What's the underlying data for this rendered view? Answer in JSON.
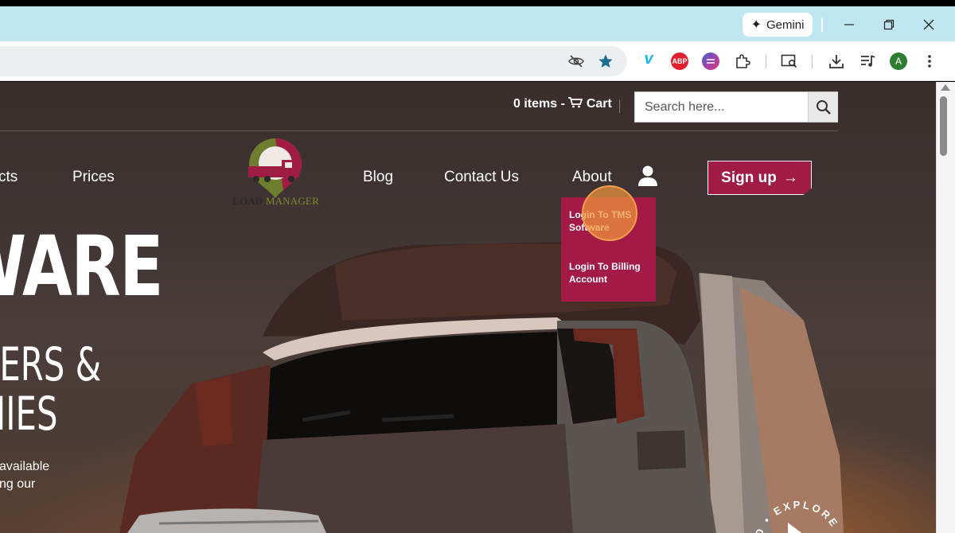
{
  "browser": {
    "gemini_label": "Gemini",
    "window_controls": [
      "minimize-icon",
      "restore-icon",
      "close-icon"
    ],
    "profile_initial": "A",
    "extensions": [
      "vimeo-icon",
      "adblock-plus-icon",
      "extension-icon",
      "puzzle-icon"
    ],
    "abp_label": "ABP"
  },
  "header": {
    "cart_text": "0 items -",
    "cart_label": "Cart",
    "search_placeholder": "Search here..."
  },
  "nav": {
    "items": [
      {
        "label": "cts"
      },
      {
        "label": "Prices"
      },
      {
        "label": "Blog"
      },
      {
        "label": "Contact Us"
      },
      {
        "label": "About"
      }
    ],
    "signup_label": "Sign up",
    "signup_arrow": "→"
  },
  "logo": {
    "text_a": "LOAD",
    "text_b": "MANAGER",
    "brand_color": "#a11c45",
    "accent_color": "#7d8b30"
  },
  "dropdown": {
    "items": [
      {
        "label": "Login To TMS Software"
      },
      {
        "label": "Login To Billing Account"
      }
    ]
  },
  "hero": {
    "line1": "TWARE",
    "line2": "KERS &",
    "line3": "NIES",
    "para_line1": "available",
    "para_line2": "ng our"
  },
  "explore": {
    "text": "TO • EXPLORE M"
  }
}
